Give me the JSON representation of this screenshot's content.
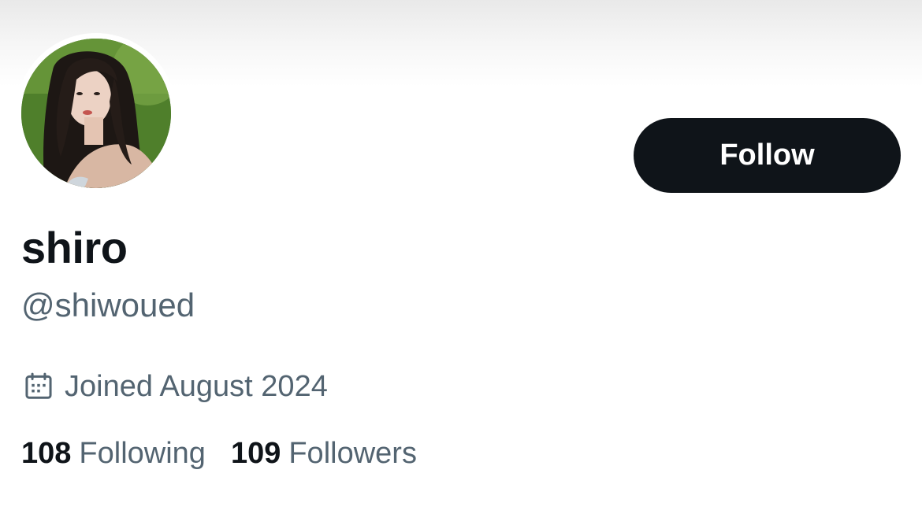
{
  "profile": {
    "display_name": "shiro",
    "handle": "@shiwoued",
    "joined_text": "Joined August 2024",
    "avatar_icon": "profile-photo"
  },
  "actions": {
    "follow_label": "Follow"
  },
  "stats": {
    "following_count": "108",
    "following_label": "Following",
    "followers_count": "109",
    "followers_label": "Followers"
  },
  "colors": {
    "primary_text": "#0f1419",
    "secondary_text": "#536471",
    "button_bg": "#0f1419",
    "button_text": "#ffffff"
  },
  "icons": {
    "joined": "calendar-icon"
  }
}
